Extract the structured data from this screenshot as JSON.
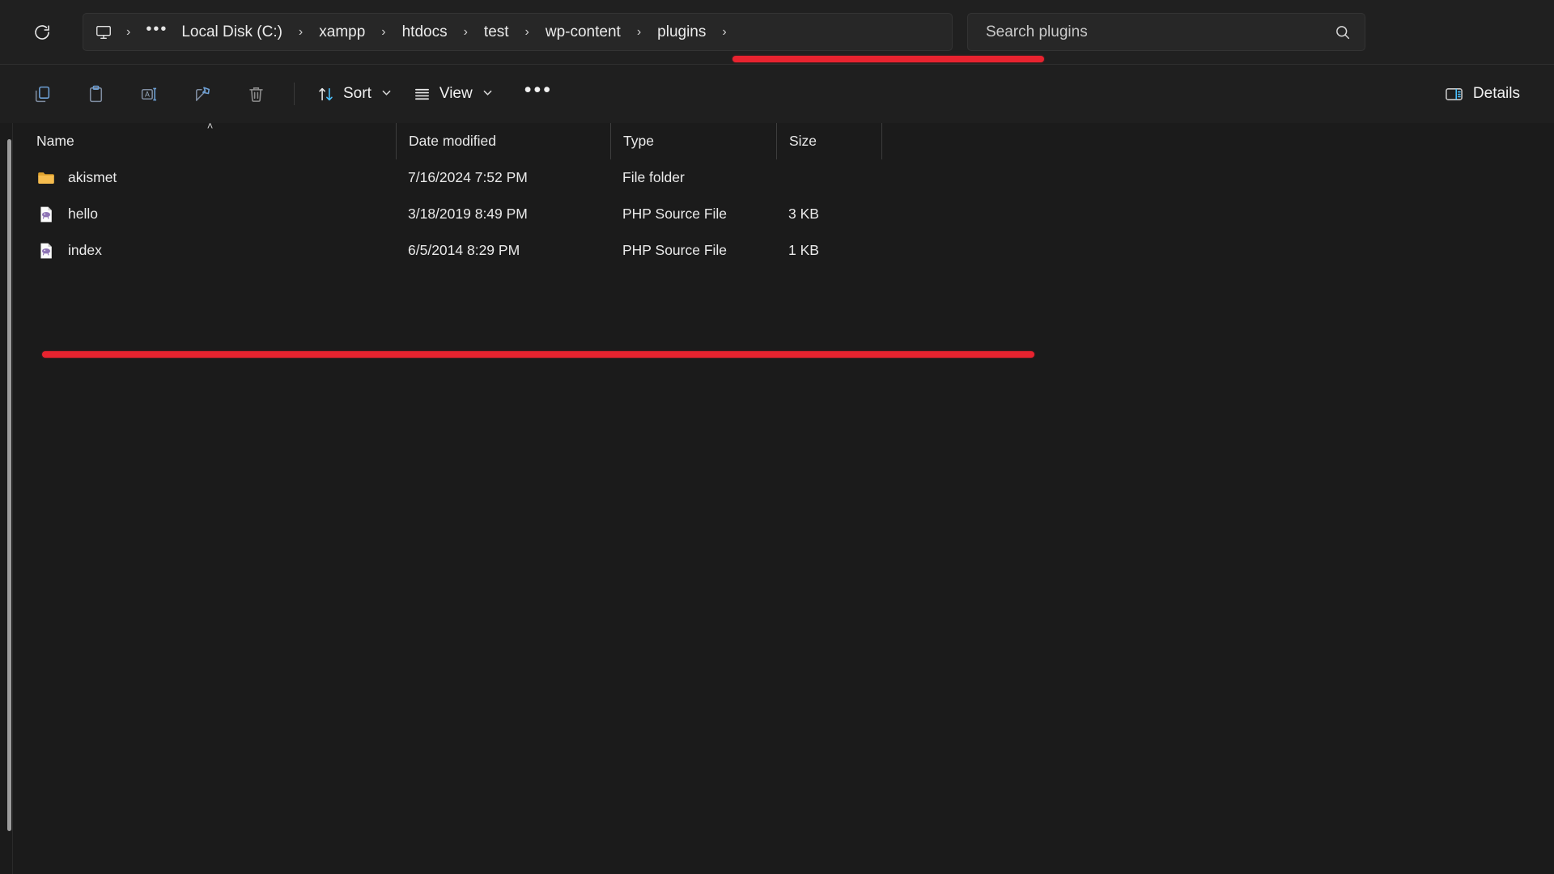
{
  "window": {
    "app": "File Explorer",
    "theme": "dark"
  },
  "addressbar": {
    "refresh_icon": "refresh-icon",
    "pc_icon": "this-pc-icon",
    "overflow_label": "•••",
    "separator": "›",
    "breadcrumbs": [
      {
        "label": "Local Disk (C:)"
      },
      {
        "label": "xampp"
      },
      {
        "label": "htdocs"
      },
      {
        "label": "test"
      },
      {
        "label": "wp-content"
      },
      {
        "label": "plugins"
      }
    ]
  },
  "search": {
    "placeholder": "Search plugins",
    "value": "",
    "icon": "search-icon"
  },
  "toolbar": {
    "icons": [
      {
        "name": "copy-icon",
        "tooltip": "Copy"
      },
      {
        "name": "paste-icon",
        "tooltip": "Paste"
      },
      {
        "name": "rename-icon",
        "tooltip": "Rename"
      },
      {
        "name": "share-icon",
        "tooltip": "Share"
      },
      {
        "name": "delete-icon",
        "tooltip": "Delete"
      }
    ],
    "sort_label": "Sort",
    "view_label": "View",
    "overflow_label": "•••",
    "details_label": "Details",
    "chevron": "⌄"
  },
  "columns": {
    "name": "Name",
    "date_modified": "Date modified",
    "type": "Type",
    "size": "Size",
    "sort_indicator": "˄",
    "sorted_by": "Name",
    "sort_direction": "ascending"
  },
  "files": [
    {
      "name": "akismet",
      "date_modified": "7/16/2024 7:52 PM",
      "type": "File folder",
      "size": "",
      "icon": "folder-icon"
    },
    {
      "name": "hello",
      "date_modified": "3/18/2019 8:49 PM",
      "type": "PHP Source File",
      "size": "3 KB",
      "icon": "php-file-icon"
    },
    {
      "name": "index",
      "date_modified": "6/5/2014 8:29 PM",
      "type": "PHP Source File",
      "size": "1 KB",
      "icon": "php-file-icon"
    }
  ],
  "annotations": {
    "color": "#e8232f",
    "marks": [
      {
        "name": "breadcrumb-underline"
      },
      {
        "name": "file-list-underline"
      }
    ]
  },
  "colors": {
    "accent": "#4cc2ff",
    "annotation_red": "#e8232f",
    "folder_yellow": "#f2b33d",
    "php_purple": "#8e74b5",
    "chrome_bg": "#202020",
    "content_bg": "#1b1b1b"
  }
}
